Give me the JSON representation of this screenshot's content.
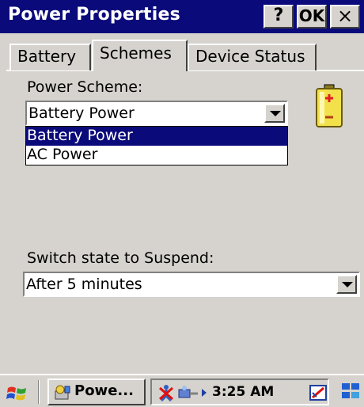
{
  "window": {
    "title": "Power Properties",
    "help_label": "?",
    "ok_label": "OK",
    "close_label": "×"
  },
  "tabs": [
    {
      "label": "Battery"
    },
    {
      "label": "Schemes",
      "selected": true
    },
    {
      "label": "Device Status"
    }
  ],
  "power_scheme": {
    "label": "Power Scheme:",
    "value": "Battery Power",
    "options": [
      "Battery Power",
      "AC Power"
    ],
    "highlighted_option": "Battery Power"
  },
  "suspend": {
    "label": "Switch state to Suspend:",
    "value": "After 5 minutes"
  },
  "taskbar": {
    "task_label": "Powe...",
    "clock": "3:25 AM"
  },
  "colors": {
    "title_bar": "#0a0a7a",
    "selection": "#0a0a7a",
    "face": "#d6d3ce",
    "battery_body": "#f2e14a",
    "battery_plus": "#e02020"
  },
  "icons": {
    "battery": "battery-icon",
    "start": "windows-start-icon",
    "task": "power-app-icon",
    "tray": [
      "network-disconnected-icon",
      "connection-icon",
      "tray-arrow-icon",
      "input-panel-icon",
      "desktop-icon"
    ]
  }
}
